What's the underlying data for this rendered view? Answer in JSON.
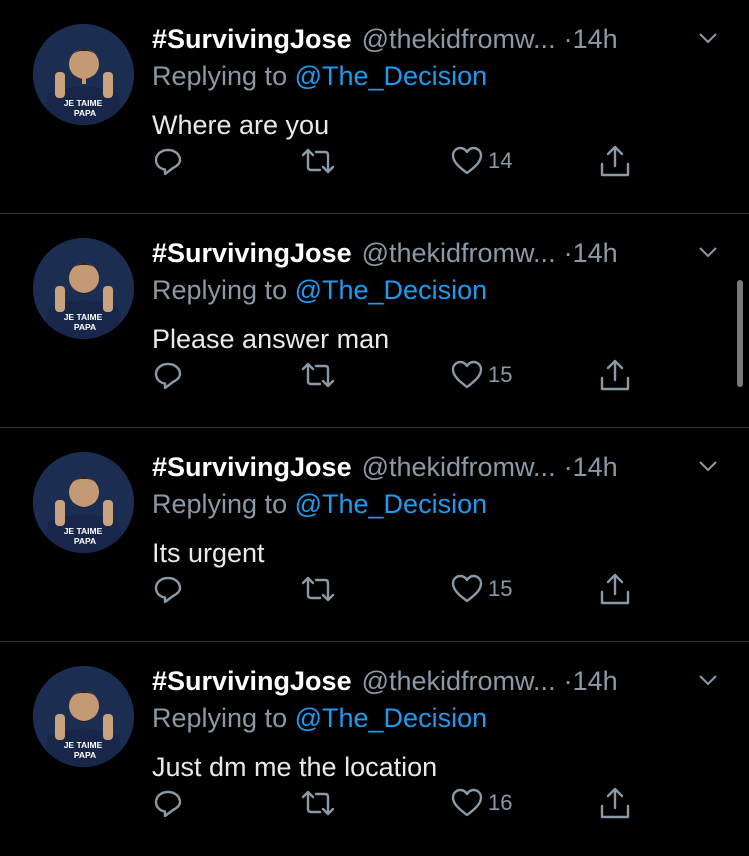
{
  "tweets": [
    {
      "display_name": "#SurvivingJose",
      "handle": "@thekidfromw...",
      "sep": "·",
      "time": "14h",
      "reply_prefix": "Replying to",
      "reply_to": "@The_Decision",
      "text": "Where are you",
      "likes": "14"
    },
    {
      "display_name": "#SurvivingJose",
      "handle": "@thekidfromw...",
      "sep": "·",
      "time": "14h",
      "reply_prefix": "Replying to",
      "reply_to": "@The_Decision",
      "text": "Please answer man",
      "likes": "15"
    },
    {
      "display_name": "#SurvivingJose",
      "handle": "@thekidfromw...",
      "sep": "·",
      "time": "14h",
      "reply_prefix": "Replying to",
      "reply_to": "@The_Decision",
      "text": "Its urgent",
      "likes": "15"
    },
    {
      "display_name": "#SurvivingJose",
      "handle": "@thekidfromw...",
      "sep": "·",
      "time": "14h",
      "reply_prefix": "Replying to",
      "reply_to": "@The_Decision",
      "text": "Just dm me the location",
      "likes": "16"
    }
  ],
  "avatar_jersey_text": [
    "JE TAIME",
    "PAPA"
  ],
  "colors": {
    "background": "#000000",
    "secondary_text": "#8b98a5",
    "link": "#1d9bf0",
    "divider": "#2f3336"
  }
}
